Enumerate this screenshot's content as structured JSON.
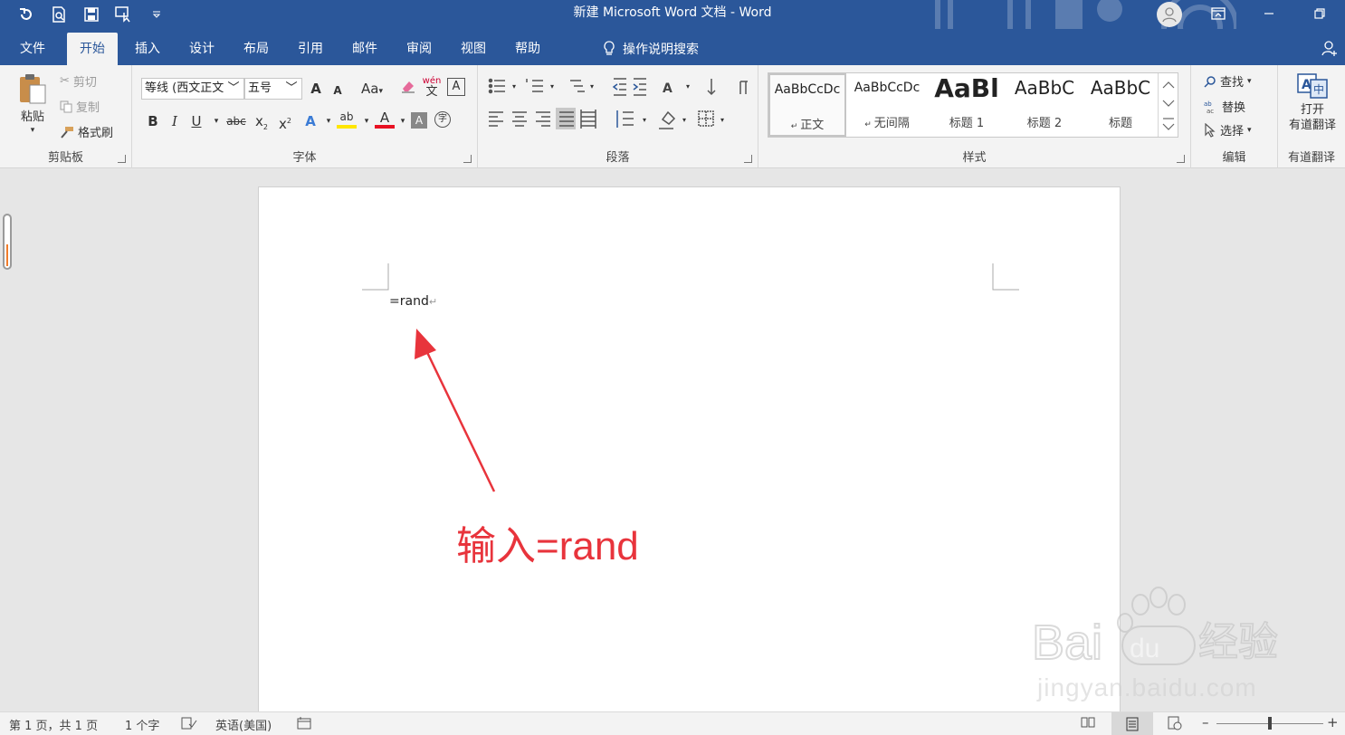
{
  "window": {
    "title": "新建 Microsoft Word 文档 - Word"
  },
  "quick_access": [
    "undo-icon",
    "print-preview-icon",
    "save-icon",
    "touch-mode-icon",
    "customize-icon"
  ],
  "tabs": [
    {
      "label": "文件"
    },
    {
      "label": "开始",
      "active": true
    },
    {
      "label": "插入"
    },
    {
      "label": "设计"
    },
    {
      "label": "布局"
    },
    {
      "label": "引用"
    },
    {
      "label": "邮件"
    },
    {
      "label": "审阅"
    },
    {
      "label": "视图"
    },
    {
      "label": "帮助"
    }
  ],
  "tell_me": "操作说明搜索",
  "ribbon": {
    "clipboard": {
      "label": "剪贴板",
      "paste": "粘贴",
      "cut": "剪切",
      "copy": "复制",
      "format_painter": "格式刷"
    },
    "font": {
      "label": "字体",
      "font_name": "等线 (西文正文",
      "font_size": "五号",
      "grow": "A",
      "shrink": "A",
      "case": "Aa",
      "wen": "wén",
      "wen_char": "文",
      "border_a": "A",
      "bold": "B",
      "italic": "I",
      "underline": "U",
      "strike": "abc",
      "sub": "x",
      "sup": "x",
      "effects": "A",
      "highlight": "ab",
      "color": "A",
      "shade": "A",
      "circle": "字"
    },
    "paragraph": {
      "label": "段落"
    },
    "styles": {
      "label": "样式",
      "items": [
        {
          "preview": "AaBbCcDc",
          "name": "正文"
        },
        {
          "preview": "AaBbCcDc",
          "name": "无间隔"
        },
        {
          "preview": "AaBl",
          "name": "标题 1"
        },
        {
          "preview": "AaBbC",
          "name": "标题 2"
        },
        {
          "preview": "AaBbC",
          "name": "标题"
        }
      ]
    },
    "editing": {
      "label": "编辑",
      "find": "查找",
      "replace": "替换",
      "select": "选择"
    },
    "youdao": {
      "label": "有道翻译",
      "open": "打开",
      "translate": "有道翻译"
    }
  },
  "document": {
    "body_text": "=rand",
    "annotation": "输入=rand",
    "watermark_brand": "Bai",
    "watermark_du": "du",
    "watermark_cn": "经验",
    "watermark_url": "jingyan.baidu.com"
  },
  "status": {
    "page": "第 1 页，共 1 页",
    "words": "1 个字",
    "language": "英语(美国)"
  },
  "colors": {
    "brand": "#2b579a",
    "annotation": "#e8343c"
  }
}
